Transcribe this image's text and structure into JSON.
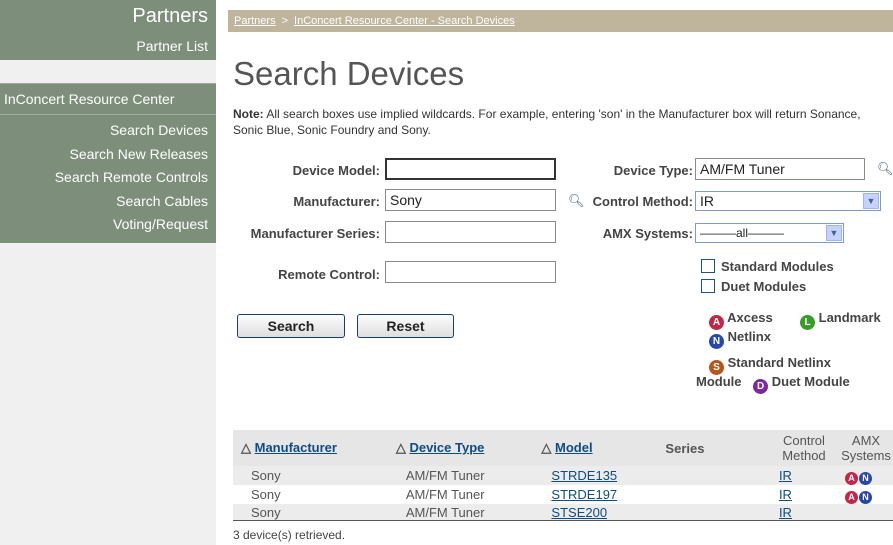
{
  "sidebar": {
    "title": "Partners",
    "partner_list": "Partner List",
    "section": "InConcert Resource Center",
    "items": [
      {
        "label": "Search Devices"
      },
      {
        "label": "Search New Releases"
      },
      {
        "label": "Search Remote Controls"
      },
      {
        "label": "Search Cables"
      },
      {
        "label": "Voting/Request"
      }
    ]
  },
  "breadcrumb": {
    "root": "Partners",
    "separator": ">",
    "current": "InConcert Resource Center - Search Devices"
  },
  "page_title": "Search Devices",
  "note": {
    "label": "Note:",
    "text": " All search boxes use implied wildcards. For example, entering 'son' in the Manufacturer box will return Sonance, Sonic Blue, Sonic Foundry and Sony."
  },
  "form": {
    "device_model_label": "Device Model:",
    "device_model_value": "",
    "manufacturer_label": "Manufacturer:",
    "manufacturer_value": "Sony",
    "manufacturer_series_label": "Manufacturer Series:",
    "manufacturer_series_value": "",
    "remote_control_label": "Remote Control:",
    "remote_control_value": "",
    "device_type_label": "Device Type:",
    "device_type_value": "AM/FM Tuner",
    "control_method_label": "Control Method:",
    "control_method_value": "IR",
    "amx_systems_label": "AMX Systems:",
    "amx_systems_value": "———all———",
    "standard_modules_label": "Standard Modules",
    "duet_modules_label": "Duet Modules",
    "search_label": "Search",
    "reset_label": "Reset"
  },
  "legend": {
    "axcess": "Axcess",
    "landmark": "Landmark",
    "netlinx": "Netlinx",
    "standard_netlinx": "Standard Netlinx",
    "module": "Module",
    "duet_module": "Duet Module",
    "letters": {
      "axcess": "A",
      "landmark": "L",
      "netlinx": "N",
      "standard": "S",
      "duet": "D"
    },
    "colors": {
      "axcess": "#c0284a",
      "landmark": "#3a9a2a",
      "netlinx": "#2748a8",
      "standard": "#b8551e",
      "duet": "#7a2a9a"
    }
  },
  "table": {
    "headers": {
      "sort_icon": "△",
      "manufacturer": "Manufacturer",
      "device_type": "Device Type",
      "model": "Model",
      "series": "Series",
      "control_method": "Control Method",
      "amx_systems": "AMX Systems"
    },
    "rows": [
      {
        "manufacturer": "Sony",
        "device_type": "AM/FM Tuner",
        "model": "STRDE135",
        "series": "",
        "control_method": "IR"
      },
      {
        "manufacturer": "Sony",
        "device_type": "AM/FM Tuner",
        "model": "STRDE197",
        "series": "",
        "control_method": "IR"
      },
      {
        "manufacturer": "Sony",
        "device_type": "AM/FM Tuner",
        "model": "STSE200",
        "series": "",
        "control_method": "IR"
      }
    ]
  },
  "result_count": "3 device(s) retrieved."
}
